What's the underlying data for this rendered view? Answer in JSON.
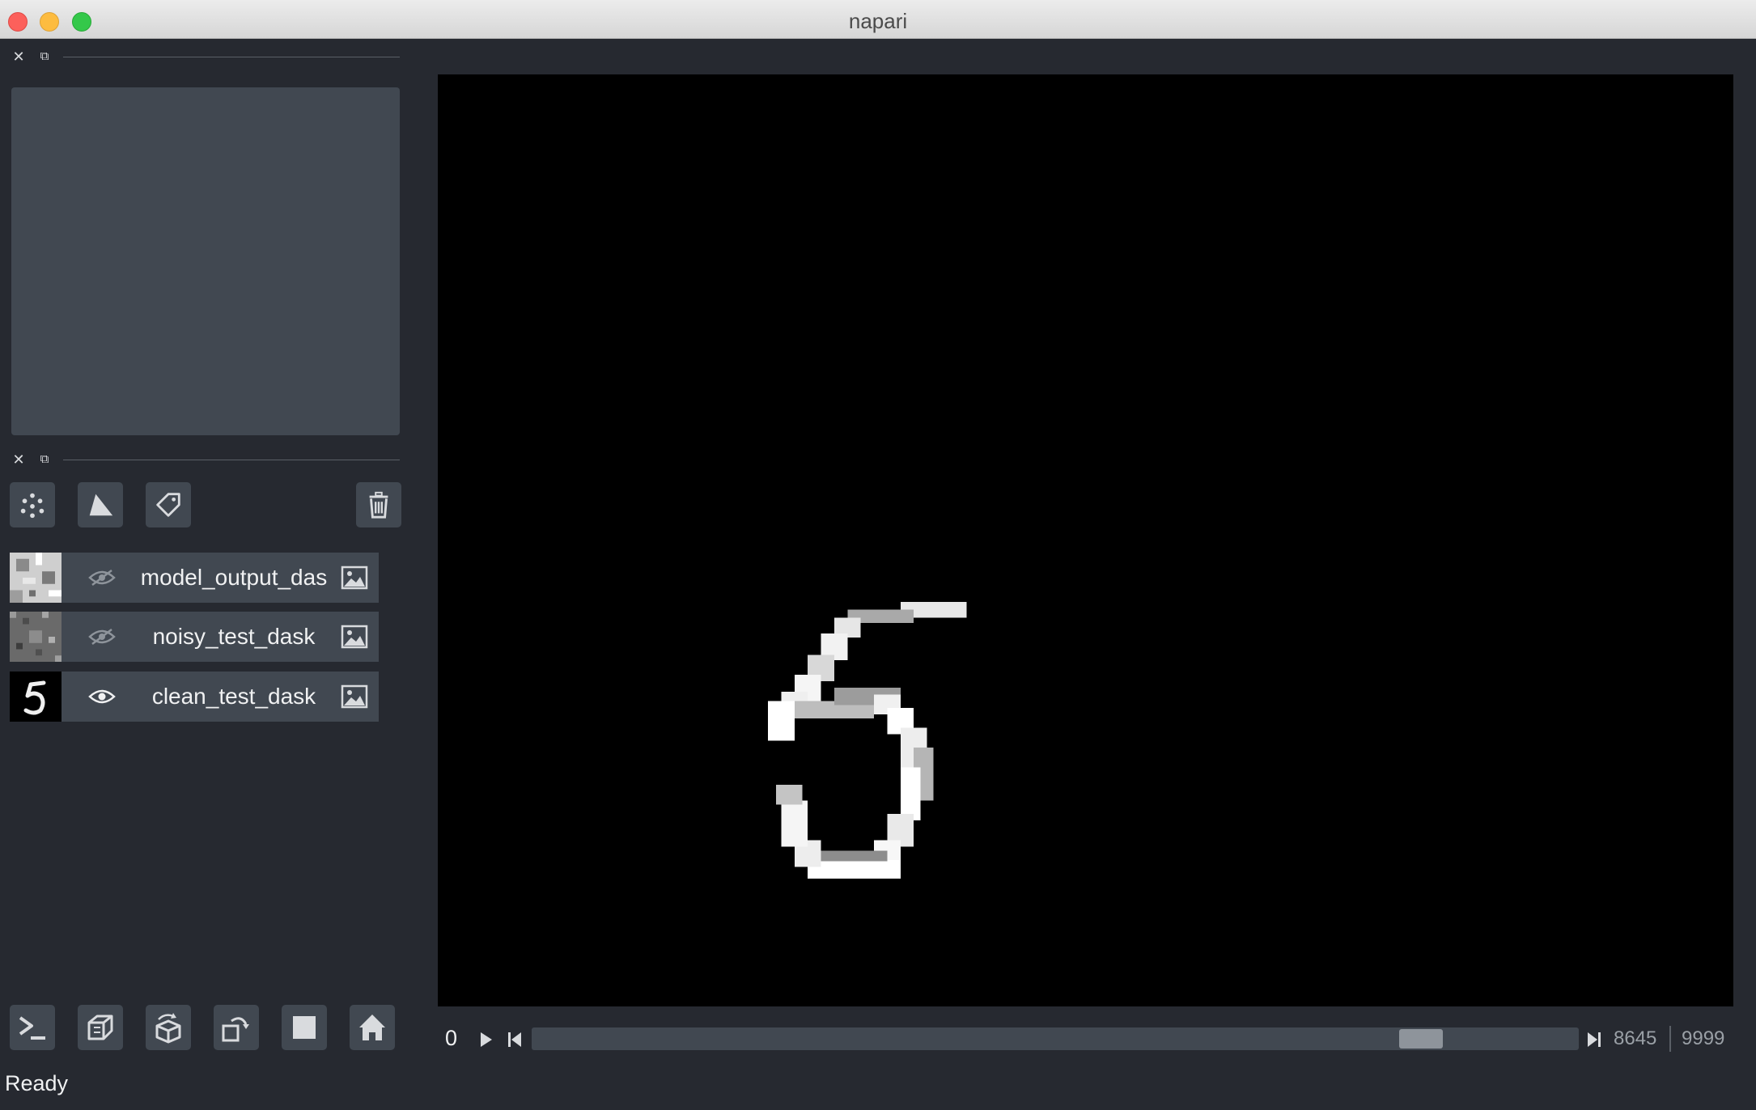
{
  "window": {
    "title": "napari"
  },
  "layer_buttons": [
    {
      "name": "new-points-button",
      "icon": "points-icon"
    },
    {
      "name": "new-shapes-button",
      "icon": "shapes-icon"
    },
    {
      "name": "new-labels-button",
      "icon": "labels-icon"
    },
    {
      "name": "delete-layer-button",
      "icon": "trash-icon"
    }
  ],
  "layers": [
    {
      "name": "model_output_das",
      "visible": false,
      "type_icon": "image-icon"
    },
    {
      "name": "noisy_test_dask",
      "visible": false,
      "type_icon": "image-icon"
    },
    {
      "name": "clean_test_dask",
      "visible": true,
      "type_icon": "image-icon"
    }
  ],
  "bottom_buttons": [
    {
      "name": "console-button",
      "icon": "console-icon"
    },
    {
      "name": "ndisplay-button",
      "icon": "cube-icon"
    },
    {
      "name": "roll-dims-button",
      "icon": "roll-icon"
    },
    {
      "name": "transpose-button",
      "icon": "transpose-icon"
    },
    {
      "name": "grid-button",
      "icon": "square-icon"
    },
    {
      "name": "home-button",
      "icon": "home-icon"
    }
  ],
  "status": {
    "text": "Ready"
  },
  "dims": {
    "axis_value": "0",
    "current": "8645",
    "max": "9999",
    "position": 8645,
    "range": [
      0,
      9999
    ]
  },
  "colors": {
    "background": "#262930",
    "panel": "#414851",
    "canvas": "#000000",
    "text": "#f0f1f2"
  }
}
